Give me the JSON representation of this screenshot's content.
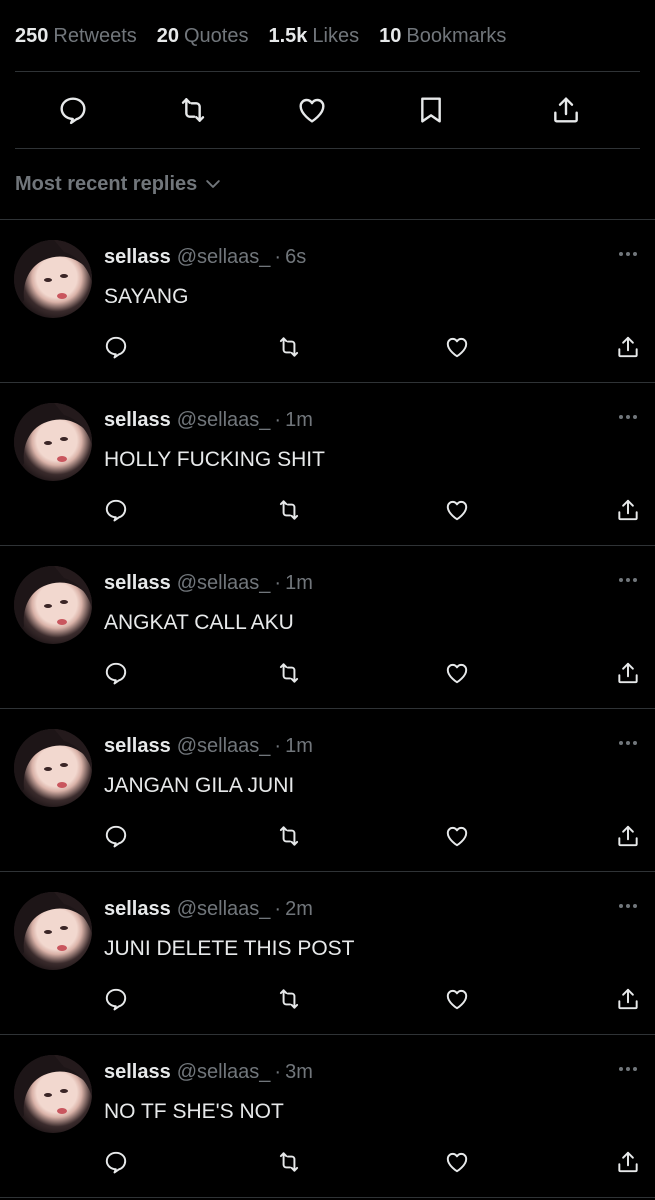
{
  "stats": [
    {
      "num": "250",
      "label": "Retweets"
    },
    {
      "num": "20",
      "label": "Quotes"
    },
    {
      "num": "1.5k",
      "label": "Likes"
    },
    {
      "num": "10",
      "label": "Bookmarks"
    }
  ],
  "action_icons": [
    "reply-icon",
    "retweet-icon",
    "like-icon",
    "bookmark-icon",
    "share-icon"
  ],
  "sort": {
    "label": "Most recent replies"
  },
  "replies": [
    {
      "display_name": "sellass",
      "handle": "@sellaas_",
      "dot": "·",
      "time": "6s",
      "text": "SAYANG"
    },
    {
      "display_name": "sellass",
      "handle": "@sellaas_",
      "dot": "·",
      "time": "1m",
      "text": "HOLLY FUCKING SHIT"
    },
    {
      "display_name": "sellass",
      "handle": "@sellaas_",
      "dot": "·",
      "time": "1m",
      "text": "ANGKAT CALL AKU"
    },
    {
      "display_name": "sellass",
      "handle": "@sellaas_",
      "dot": "·",
      "time": "1m",
      "text": "JANGAN GILA JUNI"
    },
    {
      "display_name": "sellass",
      "handle": "@sellaas_",
      "dot": "·",
      "time": "2m",
      "text": "JUNI DELETE THIS POST"
    },
    {
      "display_name": "sellass",
      "handle": "@sellaas_",
      "dot": "·",
      "time": "3m",
      "text": "NO TF SHE'S NOT"
    }
  ],
  "colors": {
    "background": "#000000",
    "primary_text": "#e7e9ea",
    "secondary_text": "#71767b",
    "divider": "#2f3336"
  }
}
